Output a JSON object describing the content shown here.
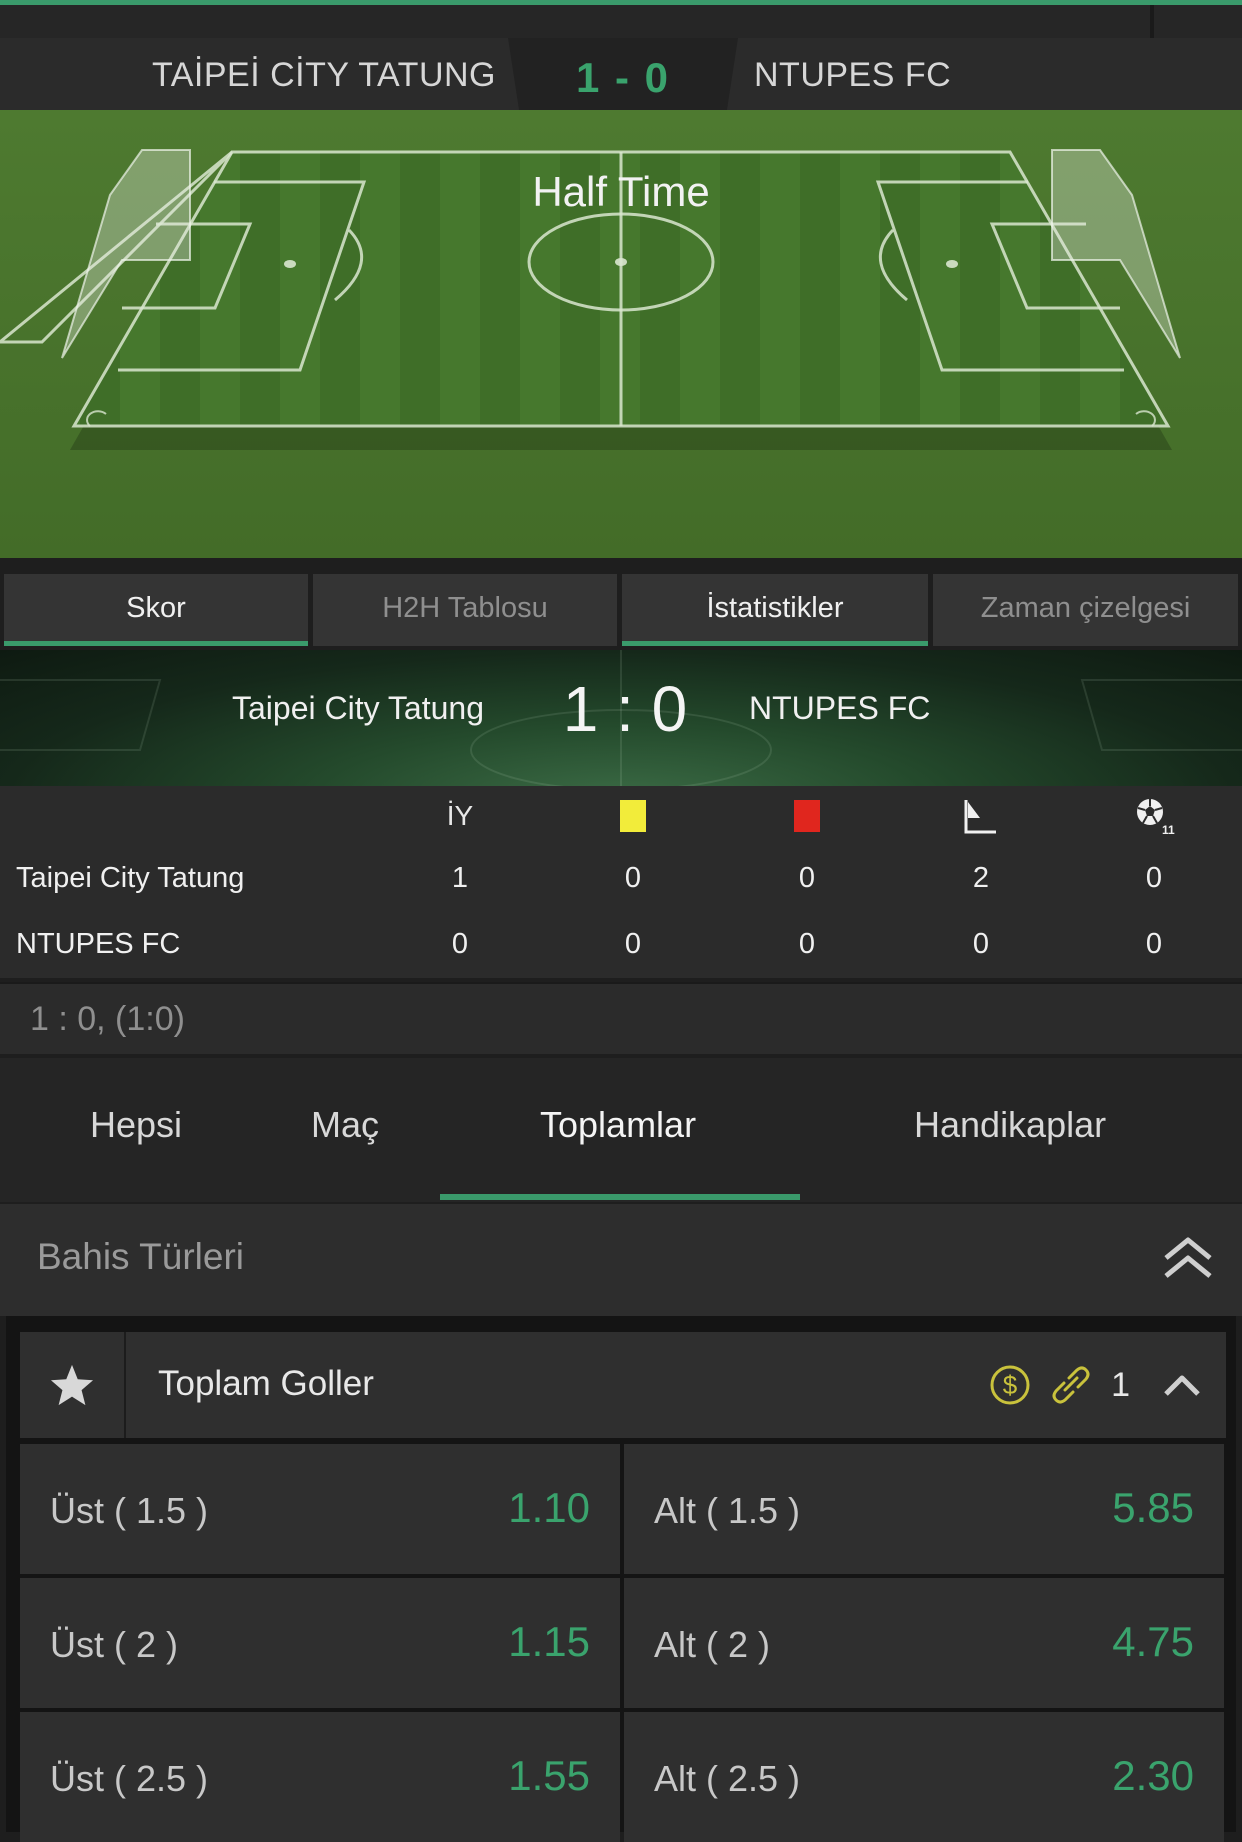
{
  "match_header": {
    "home": "TAİPEİ CİTY TATUNG",
    "score": "1 - 0",
    "away": "NTUPES FC"
  },
  "pitch": {
    "status": "Half Time"
  },
  "tabs": [
    {
      "label": "Skor",
      "active": true
    },
    {
      "label": "H2H Tablosu",
      "active": false
    },
    {
      "label": "İstatistikler",
      "active": true
    },
    {
      "label": "Zaman çizelgesi",
      "active": false
    }
  ],
  "scoreboard": {
    "home": "Taipei City Tatung",
    "score": "1 : 0",
    "away": "NTUPES FC"
  },
  "stats": {
    "headers": {
      "half_time": "İY",
      "yellow": "yellow-card-icon",
      "red": "red-card-icon",
      "corner": "corner-flag-icon",
      "penalty": "penalty-ball-icon",
      "penalty_sub": "11"
    },
    "rows": [
      {
        "team": "Taipei City Tatung",
        "half_time": "1",
        "yellow": "0",
        "red": "0",
        "corners": "2",
        "penalties": "0"
      },
      {
        "team": "NTUPES FC",
        "half_time": "0",
        "yellow": "0",
        "red": "0",
        "corners": "0",
        "penalties": "0"
      }
    ]
  },
  "score_summary": "1 : 0, (1:0)",
  "market_tabs": [
    {
      "label": "Hepsi",
      "active": false
    },
    {
      "label": "Maç",
      "active": false
    },
    {
      "label": "Toplamlar",
      "active": true
    },
    {
      "label": "Handikaplar",
      "active": false
    }
  ],
  "bet_types": {
    "label": "Bahis Türleri",
    "icon": "double-chevron-up-icon"
  },
  "market": {
    "title": "Toplam Goller",
    "count": "1",
    "icons": [
      "star-icon",
      "cashout-dollar-icon",
      "link-icon",
      "chevron-up-icon"
    ],
    "odds": [
      {
        "over_label": "Üst ( 1.5 )",
        "over_value": "1.10",
        "under_label": "Alt ( 1.5 )",
        "under_value": "5.85"
      },
      {
        "over_label": "Üst ( 2 )",
        "over_value": "1.15",
        "under_label": "Alt ( 2 )",
        "under_value": "4.75"
      },
      {
        "over_label": "Üst ( 2.5 )",
        "over_value": "1.55",
        "under_label": "Alt ( 2.5 )",
        "under_value": "2.30"
      }
    ]
  },
  "colors": {
    "accent": "#3a9a6b",
    "odds": "#3aa36d",
    "yellow_card": "#f2ec3a",
    "red_card": "#e0261e",
    "icon_gold": "#c9c23c"
  }
}
